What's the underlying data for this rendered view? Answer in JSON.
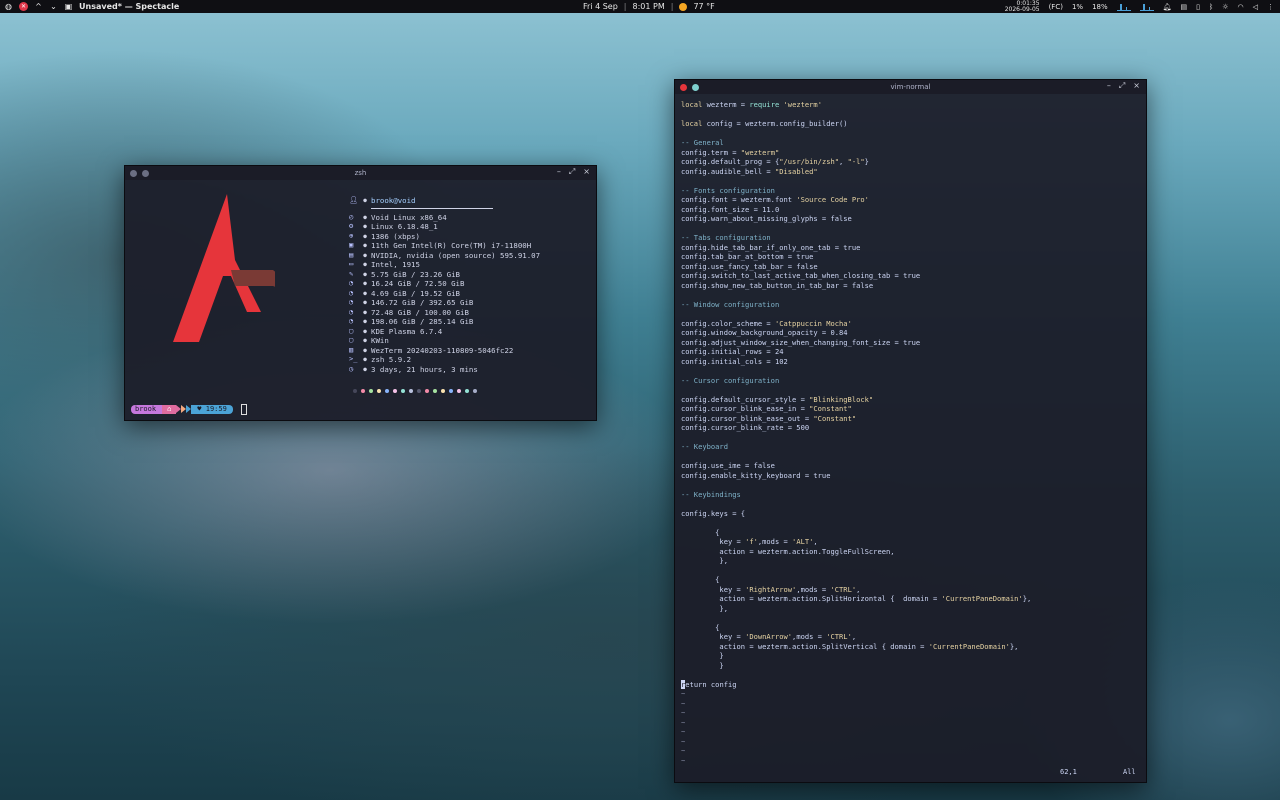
{
  "topbar": {
    "app_title": "Unsaved* — Spectacle",
    "date": "Fri 4 Sep",
    "time": "8:01 PM",
    "weather": "77 °F",
    "clock_time": "0:01:35",
    "clock_date": "2026-09-05",
    "tray_a": "(FC)",
    "tray_b": "1%",
    "tray_c": "18%"
  },
  "zsh": {
    "title": "zsh",
    "user": "brook@void",
    "info": [
      {
        "icon": "◴",
        "text": "Void Linux x86_64"
      },
      {
        "icon": "⚙",
        "text": "Linux 6.18.48_1"
      },
      {
        "icon": "⊕",
        "text": "1386 (xbps)"
      },
      {
        "icon": "▣",
        "text": "11th Gen Intel(R) Core(TM) i7-11800H"
      },
      {
        "icon": "▤",
        "text": "NVIDIA, nvidia (open source) 595.91.07"
      },
      {
        "icon": "▭",
        "text": "Intel, 1915"
      },
      {
        "icon": "✎",
        "text": "5.75 GiB / 23.26 GiB"
      },
      {
        "icon": "◔",
        "text": "16.24 GiB / 72.50 GiB"
      },
      {
        "icon": "◔",
        "text": "4.69 GiB / 19.52 GiB"
      },
      {
        "icon": "◔",
        "text": "146.72 GiB / 392.65 GiB"
      },
      {
        "icon": "◔",
        "text": "72.48 GiB / 100.00 GiB"
      },
      {
        "icon": "◔",
        "text": "198.06 GiB / 285.14 GiB"
      },
      {
        "icon": "▢",
        "text": "KDE Plasma 6.7.4"
      },
      {
        "icon": "▢",
        "text": "KWin"
      },
      {
        "icon": "▥",
        "text": "WezTerm 20240203-110809-5046fc22"
      },
      {
        "icon": ">_",
        "text": "zsh 5.9.2"
      },
      {
        "icon": "◷",
        "text": "3 days, 21 hours, 3 mins"
      }
    ],
    "palette": [
      "#45475a",
      "#f38ba8",
      "#a6e3a1",
      "#f9e2af",
      "#89b4fa",
      "#f5c2e7",
      "#94e2d5",
      "#bac2de",
      "#585b70",
      "#f38ba8",
      "#a6e3a1",
      "#f9e2af",
      "#89b4fa",
      "#f5c2e7",
      "#94e2d5",
      "#a6adc8"
    ],
    "prompt": {
      "user": "brook",
      "home_icon": "⌂",
      "time_icon": "♥",
      "time": "19:59"
    }
  },
  "vim": {
    "title": "vim-normal",
    "position": "62,1",
    "scroll": "All"
  },
  "colors": {
    "accent": "#e6353b",
    "terminal_bg": "#1c1d28"
  }
}
